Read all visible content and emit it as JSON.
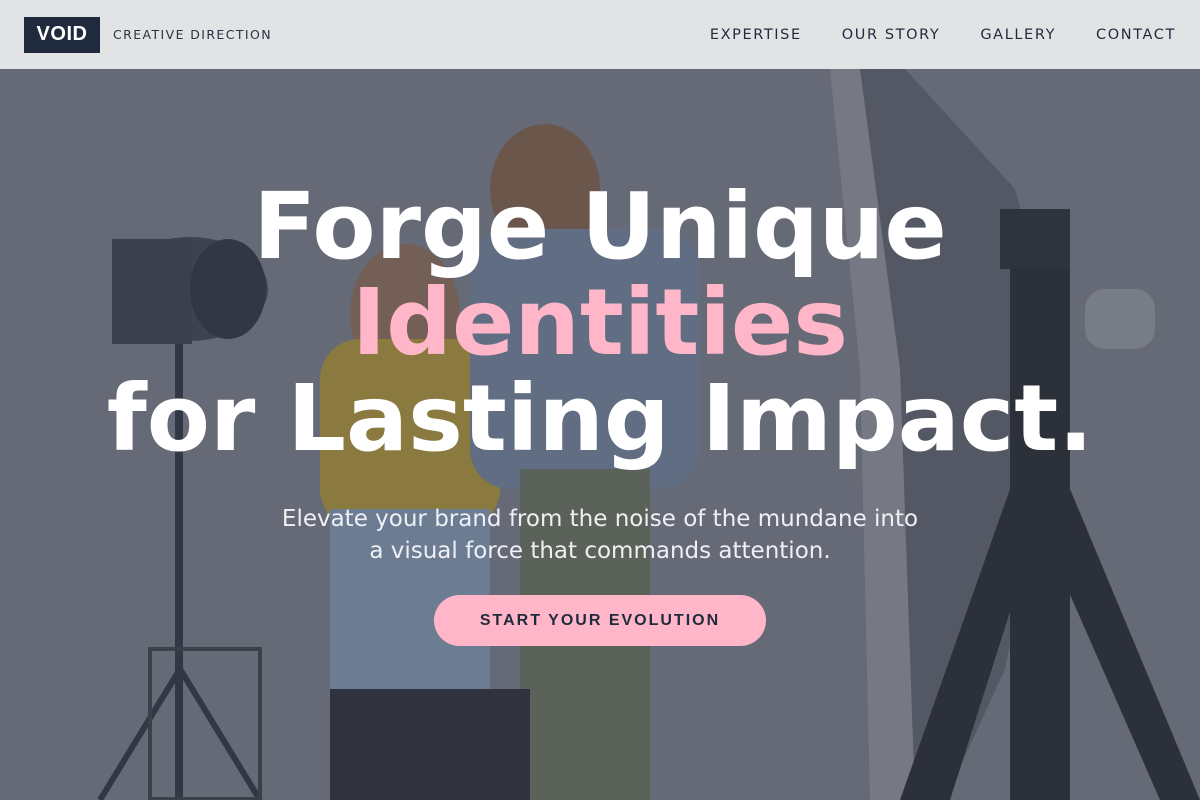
{
  "header": {
    "logo": "VOID",
    "tagline": "CREATIVE DIRECTION",
    "nav": [
      "EXPERTISE",
      "OUR STORY",
      "GALLERY",
      "CONTACT"
    ]
  },
  "hero": {
    "headline_line1": "Forge Unique",
    "headline_line2": "Identities",
    "headline_line3": "for Lasting Impact.",
    "subtitle_line1": "Elevate your brand from the noise of the mundane into",
    "subtitle_line2": "a visual force that commands attention.",
    "cta_label": "START YOUR EVOLUTION"
  },
  "colors": {
    "accent": "#ffb6c8",
    "brand_dark": "#1f2a3d",
    "header_bg": "#e2e3e5"
  }
}
